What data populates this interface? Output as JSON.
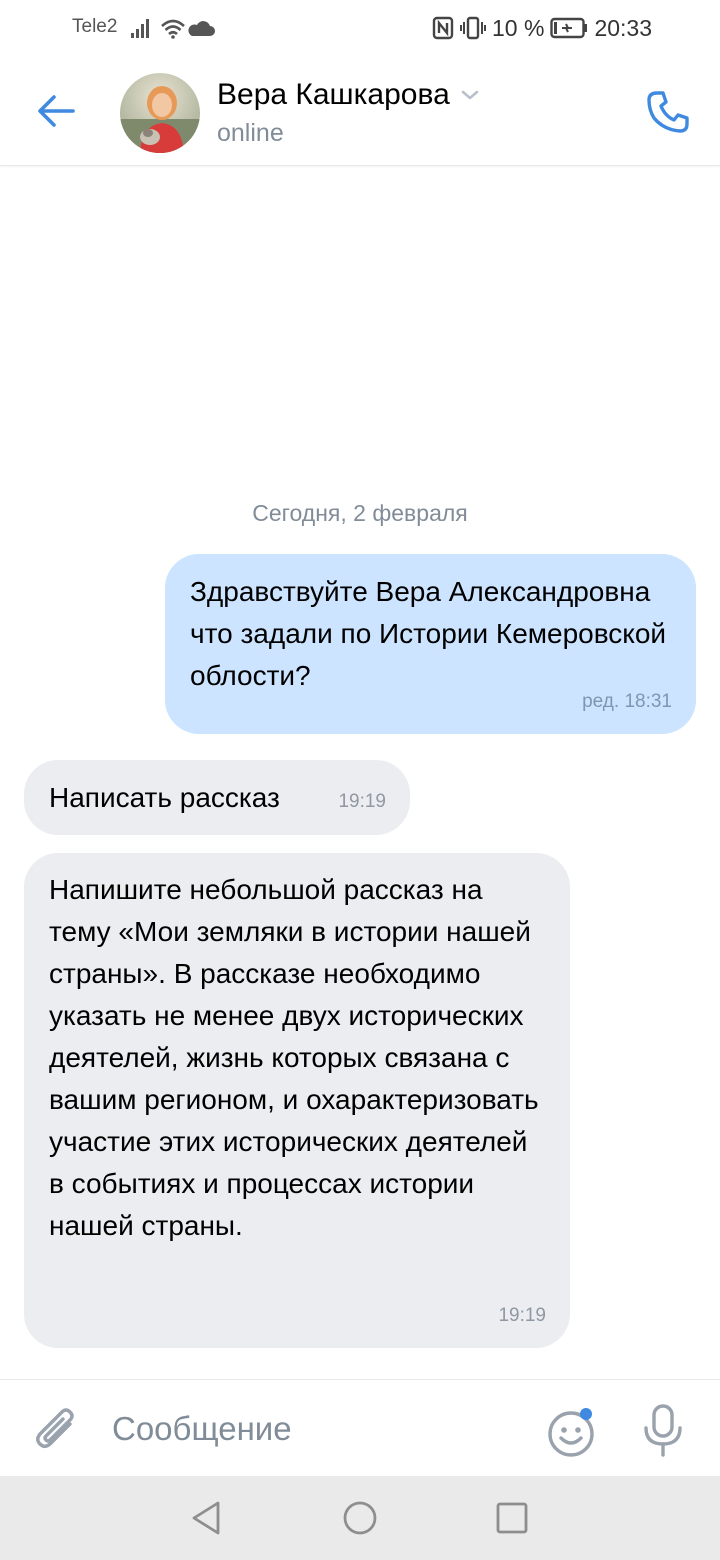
{
  "status_bar": {
    "carrier": "Tele2",
    "battery_percent": "10 %",
    "time": "20:33"
  },
  "header": {
    "contact_name": "Вера Кашкарова",
    "contact_status": "online",
    "icons": {
      "back": "arrow-left-icon",
      "dropdown": "chevron-down-icon",
      "call": "phone-icon"
    }
  },
  "chat": {
    "date_separator": "Сегодня, 2 февраля",
    "messages": [
      {
        "direction": "outgoing",
        "text": "Здравствуйте Вера Александровна что задали по Истории Кемеровской облости?",
        "time": "ред. 18:31"
      },
      {
        "direction": "incoming",
        "text": "Написать рассказ",
        "time": "19:19"
      },
      {
        "direction": "incoming",
        "text": "Напишите небольшой рассказ на тему «Мои земляки в истории нашей страны». В рассказе необходимо указать не менее двух исторических деятелей, жизнь которых связана с вашим регионом, и охарактеризовать участие этих исторических деятелей в событиях и процессах истории нашей страны.",
        "time": "19:19"
      }
    ]
  },
  "composer": {
    "placeholder": "Сообщение",
    "icons": {
      "attach": "paperclip-icon",
      "emoji": "smile-icon",
      "mic": "microphone-icon"
    }
  },
  "nav_bar": {
    "icons": [
      "nav-back-icon",
      "nav-home-icon",
      "nav-recents-icon"
    ]
  },
  "colors": {
    "accent": "#3f8ae0",
    "outgoing_bubble": "#cce4ff",
    "incoming_bubble": "#ebedf0",
    "secondary_text": "#818c99"
  }
}
